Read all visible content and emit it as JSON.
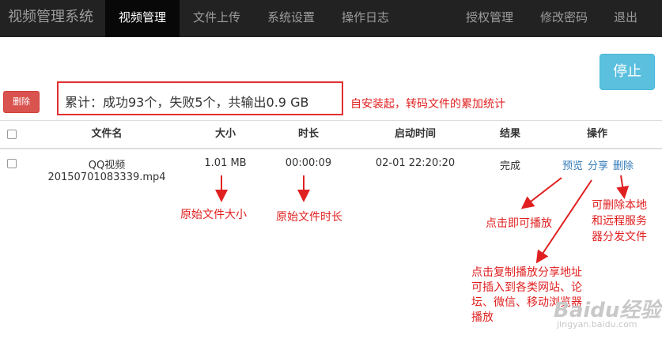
{
  "navbar": {
    "brand": "视频管理系统",
    "items": [
      {
        "label": "视频管理",
        "active": true
      },
      {
        "label": "文件上传",
        "active": false
      },
      {
        "label": "系统设置",
        "active": false
      },
      {
        "label": "操作日志",
        "active": false
      }
    ],
    "right_items": [
      {
        "label": "授权管理"
      },
      {
        "label": "修改密码"
      },
      {
        "label": "退出"
      }
    ]
  },
  "toolbar": {
    "stop_label": "停止",
    "delete_label": "删除"
  },
  "summary": {
    "text": "累计：成功93个，失败5个，共输出0.9 GB"
  },
  "table": {
    "headers": [
      "文件名",
      "大小",
      "时长",
      "启动时间",
      "结果",
      "操作"
    ],
    "rows": [
      {
        "filename_line1": "QQ视频",
        "filename_line2": "20150701083339.mp4",
        "size": "1.01 MB",
        "duration": "00:00:09",
        "start_time": "02-01 22:20:20",
        "result": "完成",
        "actions": {
          "preview": "预览",
          "share": "分享",
          "delete": "删除"
        }
      }
    ]
  },
  "annotations": {
    "summary_note": "自安装起，转码文件的累加统计",
    "size_note": "原始文件大小",
    "duration_note": "原始文件时长",
    "preview_note": "点击即可播放",
    "delete_note": [
      "可删除本地",
      "和远程服务",
      "器分发文件"
    ],
    "share_note": [
      "点击复制播放分享地址",
      "可插入到各类网站、论",
      "坛、微信、移动浏览器",
      "播放"
    ]
  },
  "watermark": {
    "logo": "Baidu经验",
    "url": "jingyan.baidu.com"
  },
  "colors": {
    "navbar_bg": "#222222",
    "nav_active_bg": "#080808",
    "stop_button": "#5bc0de",
    "delete_button": "#d9534f",
    "annotation_red": "#e02020",
    "link_blue": "#337ab7"
  }
}
